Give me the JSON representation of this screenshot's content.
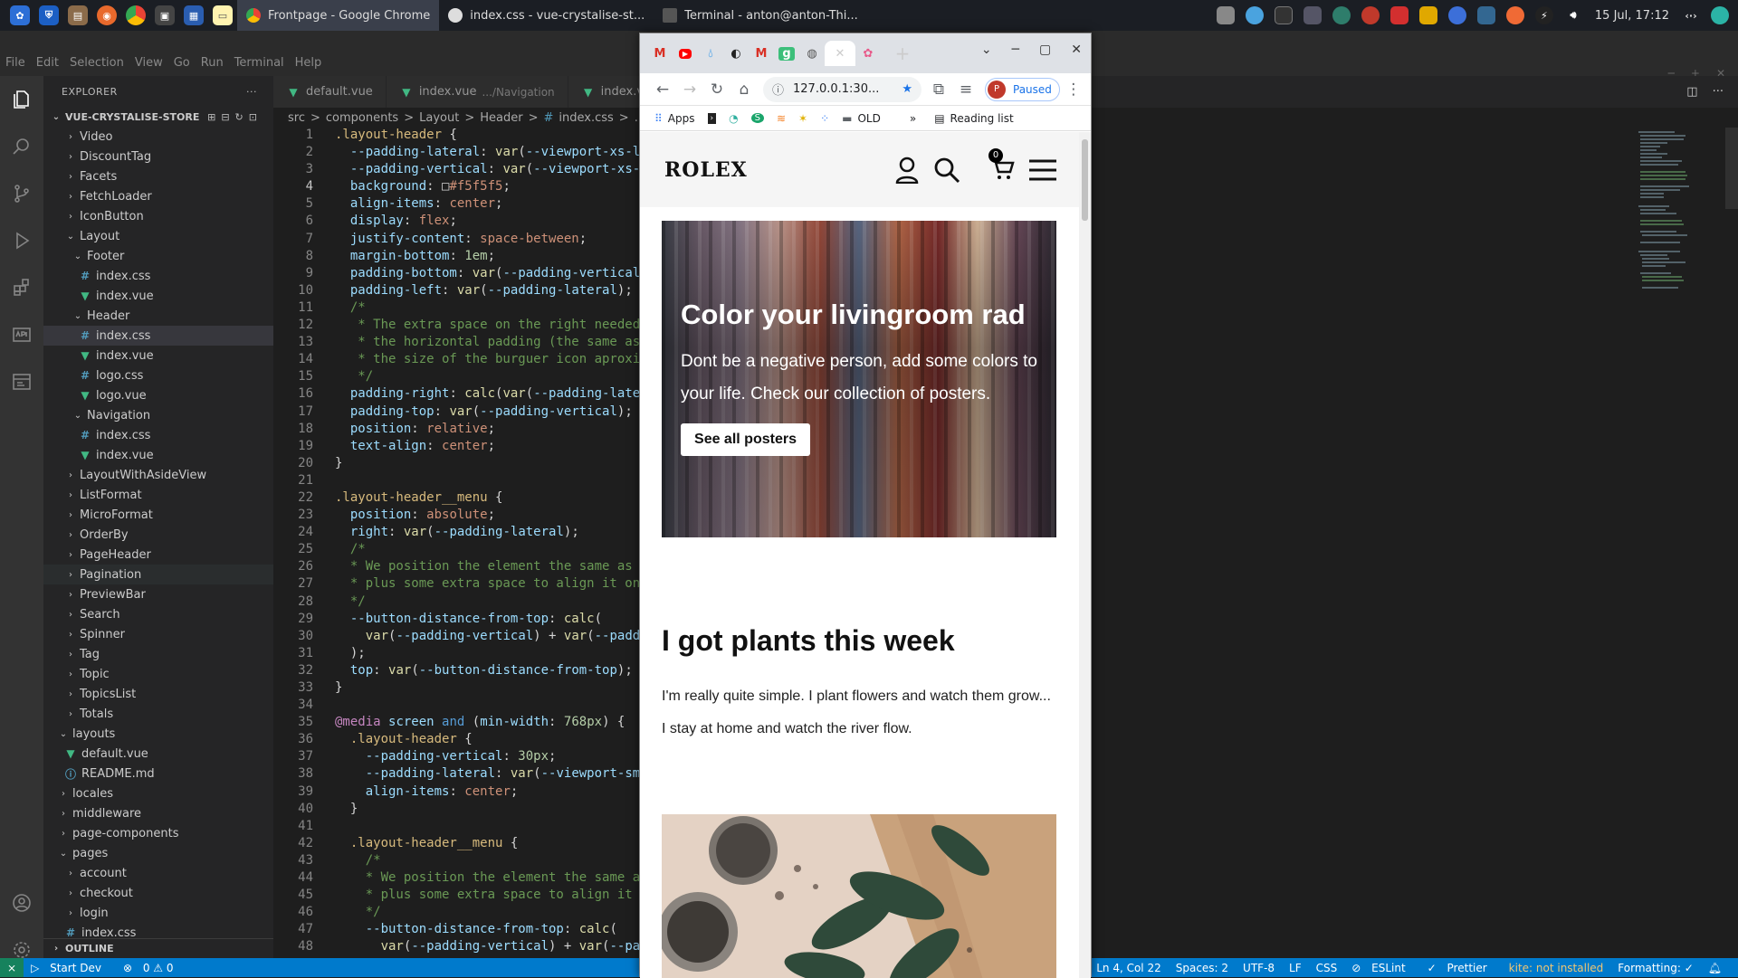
{
  "taskbar": {
    "tasks": [
      {
        "label": "Frontpage - Google Chrome"
      },
      {
        "label": "index.css - vue-crystalise-st..."
      },
      {
        "label": "Terminal - anton@anton-Thi..."
      }
    ],
    "clock": "15 Jul, 17:12"
  },
  "vscode": {
    "menu": [
      "File",
      "Edit",
      "Selection",
      "View",
      "Go",
      "Run",
      "Terminal",
      "Help"
    ],
    "explorer_title": "EXPLORER",
    "project": "VUE-CRYSTALISE-STORE",
    "tree": [
      {
        "label": "Video",
        "type": "folder",
        "depth": 2,
        "open": false
      },
      {
        "label": "DiscountTag",
        "type": "folder",
        "depth": 2,
        "open": false
      },
      {
        "label": "Facets",
        "type": "folder",
        "depth": 2,
        "open": false
      },
      {
        "label": "FetchLoader",
        "type": "folder",
        "depth": 2,
        "open": false
      },
      {
        "label": "IconButton",
        "type": "folder",
        "depth": 2,
        "open": false
      },
      {
        "label": "Layout",
        "type": "folder",
        "depth": 2,
        "open": true
      },
      {
        "label": "Footer",
        "type": "folder",
        "depth": 3,
        "open": true
      },
      {
        "label": "index.css",
        "type": "css",
        "depth": 4
      },
      {
        "label": "index.vue",
        "type": "vue",
        "depth": 4
      },
      {
        "label": "Header",
        "type": "folder",
        "depth": 3,
        "open": true
      },
      {
        "label": "index.css",
        "type": "css",
        "depth": 4,
        "selected": true
      },
      {
        "label": "index.vue",
        "type": "vue",
        "depth": 4
      },
      {
        "label": "logo.css",
        "type": "css",
        "depth": 4
      },
      {
        "label": "logo.vue",
        "type": "vue",
        "depth": 4
      },
      {
        "label": "Navigation",
        "type": "folder",
        "depth": 3,
        "open": true
      },
      {
        "label": "index.css",
        "type": "css",
        "depth": 4
      },
      {
        "label": "index.vue",
        "type": "vue",
        "depth": 4
      },
      {
        "label": "LayoutWithAsideView",
        "type": "folder",
        "depth": 2,
        "open": false
      },
      {
        "label": "ListFormat",
        "type": "folder",
        "depth": 2,
        "open": false
      },
      {
        "label": "MicroFormat",
        "type": "folder",
        "depth": 2,
        "open": false
      },
      {
        "label": "OrderBy",
        "type": "folder",
        "depth": 2,
        "open": false
      },
      {
        "label": "PageHeader",
        "type": "folder",
        "depth": 2,
        "open": false
      },
      {
        "label": "Pagination",
        "type": "folder",
        "depth": 2,
        "open": false,
        "hover": true
      },
      {
        "label": "PreviewBar",
        "type": "folder",
        "depth": 2,
        "open": false
      },
      {
        "label": "Search",
        "type": "folder",
        "depth": 2,
        "open": false
      },
      {
        "label": "Spinner",
        "type": "folder",
        "depth": 2,
        "open": false
      },
      {
        "label": "Tag",
        "type": "folder",
        "depth": 2,
        "open": false
      },
      {
        "label": "Topic",
        "type": "folder",
        "depth": 2,
        "open": false
      },
      {
        "label": "TopicsList",
        "type": "folder",
        "depth": 2,
        "open": false
      },
      {
        "label": "Totals",
        "type": "folder",
        "depth": 2,
        "open": false
      },
      {
        "label": "layouts",
        "type": "folder",
        "depth": 1,
        "open": true
      },
      {
        "label": "default.vue",
        "type": "vue",
        "depth": 2
      },
      {
        "label": "README.md",
        "type": "md",
        "depth": 2
      },
      {
        "label": "locales",
        "type": "folder",
        "depth": 1,
        "open": false
      },
      {
        "label": "middleware",
        "type": "folder",
        "depth": 1,
        "open": false
      },
      {
        "label": "page-components",
        "type": "folder",
        "depth": 1,
        "open": false
      },
      {
        "label": "pages",
        "type": "folder",
        "depth": 1,
        "open": true
      },
      {
        "label": "account",
        "type": "folder",
        "depth": 2,
        "open": false
      },
      {
        "label": "checkout",
        "type": "folder",
        "depth": 2,
        "open": false
      },
      {
        "label": "login",
        "type": "folder",
        "depth": 2,
        "open": false
      },
      {
        "label": "index.css",
        "type": "css",
        "depth": 2
      }
    ],
    "outline_label": "OUTLINE",
    "tabs": [
      {
        "label": "default.vue",
        "type": "vue",
        "detail": ""
      },
      {
        "label": "index.vue",
        "type": "vue",
        "detail": ".../Navigation"
      },
      {
        "label": "index.v",
        "type": "vue",
        "detail": ""
      }
    ],
    "breadcrumb": [
      "src",
      ">",
      "components",
      ">",
      "Layout",
      ">",
      "Header",
      ">",
      "#",
      "index.css",
      ">",
      ".layo"
    ],
    "code_lines": [
      [
        [
          "s",
          ".layout-header "
        ],
        [
          "w",
          "{"
        ]
      ],
      [
        [
          "w",
          "  "
        ],
        [
          "p",
          "--padding-lateral"
        ],
        [
          "w",
          ": "
        ],
        [
          "f",
          "var"
        ],
        [
          "w",
          "("
        ],
        [
          "p",
          "--viewport-xs-l"
        ]
      ],
      [
        [
          "w",
          "  "
        ],
        [
          "p",
          "--padding-vertical"
        ],
        [
          "w",
          ": "
        ],
        [
          "f",
          "var"
        ],
        [
          "w",
          "("
        ],
        [
          "p",
          "--viewport-xs-"
        ]
      ],
      [
        [
          "w",
          "  "
        ],
        [
          "p",
          "background"
        ],
        [
          "w",
          ": "
        ],
        [
          "w",
          "□"
        ],
        [
          "v",
          "#f5f5f5"
        ],
        [
          "w",
          ";"
        ]
      ],
      [
        [
          "w",
          "  "
        ],
        [
          "p",
          "align-items"
        ],
        [
          "w",
          ": "
        ],
        [
          "v",
          "center"
        ],
        [
          "w",
          ";"
        ]
      ],
      [
        [
          "w",
          "  "
        ],
        [
          "p",
          "display"
        ],
        [
          "w",
          ": "
        ],
        [
          "v",
          "flex"
        ],
        [
          "w",
          ";"
        ]
      ],
      [
        [
          "w",
          "  "
        ],
        [
          "p",
          "justify-content"
        ],
        [
          "w",
          ": "
        ],
        [
          "v",
          "space-between"
        ],
        [
          "w",
          ";"
        ]
      ],
      [
        [
          "w",
          "  "
        ],
        [
          "p",
          "margin-bottom"
        ],
        [
          "w",
          ": "
        ],
        [
          "n",
          "1em"
        ],
        [
          "w",
          ";"
        ]
      ],
      [
        [
          "w",
          "  "
        ],
        [
          "p",
          "padding-bottom"
        ],
        [
          "w",
          ": "
        ],
        [
          "f",
          "var"
        ],
        [
          "w",
          "("
        ],
        [
          "p",
          "--padding-vertical"
        ]
      ],
      [
        [
          "w",
          "  "
        ],
        [
          "p",
          "padding-left"
        ],
        [
          "w",
          ": "
        ],
        [
          "f",
          "var"
        ],
        [
          "w",
          "("
        ],
        [
          "p",
          "--padding-lateral"
        ],
        [
          "w",
          ");"
        ]
      ],
      [
        [
          "w",
          "  "
        ],
        [
          "c",
          "/*"
        ]
      ],
      [
        [
          "w",
          "  "
        ],
        [
          "c",
          " * The extra space on the right needed"
        ]
      ],
      [
        [
          "w",
          "  "
        ],
        [
          "c",
          " * the horizontal padding (the same as"
        ]
      ],
      [
        [
          "w",
          "  "
        ],
        [
          "c",
          " * the size of the burguer icon aproxi"
        ]
      ],
      [
        [
          "w",
          "  "
        ],
        [
          "c",
          " */"
        ]
      ],
      [
        [
          "w",
          "  "
        ],
        [
          "p",
          "padding-right"
        ],
        [
          "w",
          ": "
        ],
        [
          "f",
          "calc"
        ],
        [
          "w",
          "("
        ],
        [
          "f",
          "var"
        ],
        [
          "w",
          "("
        ],
        [
          "p",
          "--padding-late"
        ]
      ],
      [
        [
          "w",
          "  "
        ],
        [
          "p",
          "padding-top"
        ],
        [
          "w",
          ": "
        ],
        [
          "f",
          "var"
        ],
        [
          "w",
          "("
        ],
        [
          "p",
          "--padding-vertical"
        ],
        [
          "w",
          ");"
        ]
      ],
      [
        [
          "w",
          "  "
        ],
        [
          "p",
          "position"
        ],
        [
          "w",
          ": "
        ],
        [
          "v",
          "relative"
        ],
        [
          "w",
          ";"
        ]
      ],
      [
        [
          "w",
          "  "
        ],
        [
          "p",
          "text-align"
        ],
        [
          "w",
          ": "
        ],
        [
          "v",
          "center"
        ],
        [
          "w",
          ";"
        ]
      ],
      [
        [
          "w",
          "}"
        ]
      ],
      [],
      [
        [
          "s",
          ".layout-header__menu "
        ],
        [
          "w",
          "{"
        ]
      ],
      [
        [
          "w",
          "  "
        ],
        [
          "p",
          "position"
        ],
        [
          "w",
          ": "
        ],
        [
          "v",
          "absolute"
        ],
        [
          "w",
          ";"
        ]
      ],
      [
        [
          "w",
          "  "
        ],
        [
          "p",
          "right"
        ],
        [
          "w",
          ": "
        ],
        [
          "f",
          "var"
        ],
        [
          "w",
          "("
        ],
        [
          "p",
          "--padding-lateral"
        ],
        [
          "w",
          ");"
        ]
      ],
      [
        [
          "w",
          "  "
        ],
        [
          "c",
          "/*"
        ]
      ],
      [
        [
          "w",
          "  "
        ],
        [
          "c",
          "* We position the element the same as"
        ]
      ],
      [
        [
          "w",
          "  "
        ],
        [
          "c",
          "* plus some extra space to align it on"
        ]
      ],
      [
        [
          "w",
          "  "
        ],
        [
          "c",
          "*/"
        ]
      ],
      [
        [
          "w",
          "  "
        ],
        [
          "p",
          "--button-distance-from-top"
        ],
        [
          "w",
          ": "
        ],
        [
          "f",
          "calc"
        ],
        [
          "w",
          "("
        ]
      ],
      [
        [
          "w",
          "    "
        ],
        [
          "f",
          "var"
        ],
        [
          "w",
          "("
        ],
        [
          "p",
          "--padding-vertical"
        ],
        [
          "w",
          ") + "
        ],
        [
          "f",
          "var"
        ],
        [
          "w",
          "("
        ],
        [
          "p",
          "--padd"
        ]
      ],
      [
        [
          "w",
          "  );"
        ]
      ],
      [
        [
          "w",
          "  "
        ],
        [
          "p",
          "top"
        ],
        [
          "w",
          ": "
        ],
        [
          "f",
          "var"
        ],
        [
          "w",
          "("
        ],
        [
          "p",
          "--button-distance-from-top"
        ],
        [
          "w",
          ");"
        ]
      ],
      [
        [
          "w",
          "}"
        ]
      ],
      [],
      [
        [
          "k",
          "@media"
        ],
        [
          "w",
          " "
        ],
        [
          "p",
          "screen"
        ],
        [
          "w",
          " "
        ],
        [
          "m",
          "and"
        ],
        [
          "w",
          " ("
        ],
        [
          "p",
          "min-width"
        ],
        [
          "w",
          ": "
        ],
        [
          "n",
          "768px"
        ],
        [
          "w",
          ") {"
        ]
      ],
      [
        [
          "w",
          "  "
        ],
        [
          "s",
          ".layout-header "
        ],
        [
          "w",
          "{"
        ]
      ],
      [
        [
          "w",
          "    "
        ],
        [
          "p",
          "--padding-vertical"
        ],
        [
          "w",
          ": "
        ],
        [
          "n",
          "30px"
        ],
        [
          "w",
          ";"
        ]
      ],
      [
        [
          "w",
          "    "
        ],
        [
          "p",
          "--padding-lateral"
        ],
        [
          "w",
          ": "
        ],
        [
          "f",
          "var"
        ],
        [
          "w",
          "("
        ],
        [
          "p",
          "--viewport-sm"
        ]
      ],
      [
        [
          "w",
          "    "
        ],
        [
          "p",
          "align-items"
        ],
        [
          "w",
          ": "
        ],
        [
          "v",
          "center"
        ],
        [
          "w",
          ";"
        ]
      ],
      [
        [
          "w",
          "  }"
        ]
      ],
      [],
      [
        [
          "w",
          "  "
        ],
        [
          "s",
          ".layout-header__menu "
        ],
        [
          "w",
          "{"
        ]
      ],
      [
        [
          "w",
          "    "
        ],
        [
          "c",
          "/*"
        ]
      ],
      [
        [
          "w",
          "    "
        ],
        [
          "c",
          "* We position the element the same a"
        ]
      ],
      [
        [
          "w",
          "    "
        ],
        [
          "c",
          "* plus some extra space to align it"
        ]
      ],
      [
        [
          "w",
          "    "
        ],
        [
          "c",
          "*/"
        ]
      ],
      [
        [
          "w",
          "    "
        ],
        [
          "p",
          "--button-distance-from-top"
        ],
        [
          "w",
          ": "
        ],
        [
          "f",
          "calc"
        ],
        [
          "w",
          "("
        ]
      ],
      [
        [
          "w",
          "      "
        ],
        [
          "f",
          "var"
        ],
        [
          "w",
          "("
        ],
        [
          "p",
          "--padding-vertical"
        ],
        [
          "w",
          ") + "
        ],
        [
          "f",
          "var"
        ],
        [
          "w",
          "("
        ],
        [
          "p",
          "--pa"
        ]
      ]
    ],
    "current_line": 4,
    "status": {
      "remote": "⨯",
      "task": "Start Dev",
      "problems": "0 ⚠ 0",
      "position": "Ln 4, Col 22",
      "spaces": "Spaces: 2",
      "encoding": "UTF-8",
      "eol": "LF",
      "language": "CSS",
      "eslint": "ESLint",
      "prettier": "Prettier",
      "kite": "kite: not installed",
      "formatting": "Formatting: ✓"
    }
  },
  "browser": {
    "url": "127.0.0.1:30...",
    "profile_initial": "P",
    "profile_status": "Paused",
    "bookmarks": [
      "Apps",
      "OLD"
    ],
    "more_bookmarks": "»",
    "reading_list": "Reading list",
    "site": {
      "logo": "ROLEX",
      "cart_count": "0",
      "hero_title": "Color your livingroom rad",
      "hero_text": "Dont be a negative person, add some colors to your life. Check our collection of posters.",
      "hero_button": "See all posters",
      "post_title": "I got plants this week",
      "post_p1": "I'm really quite simple. I plant flowers and watch them grow...",
      "post_p2": "I stay at home and watch the river flow."
    }
  },
  "colors": {
    "accent": "#007acc",
    "header_bg": "#f5f5f5"
  }
}
